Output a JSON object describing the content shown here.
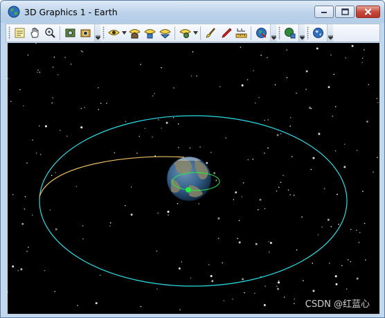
{
  "window": {
    "title": "3D Graphics 1 - Earth",
    "title_icon": "globe-icon",
    "buttons": [
      "minimize-icon",
      "maximize-icon",
      "close-icon"
    ]
  },
  "toolbar": {
    "groups": [
      [
        "properties-icon",
        "pan-hand-icon",
        "zoom-icon",
        "map-snapshot-icon",
        "camera-icon"
      ],
      [
        "view-from-icon",
        "home-view-icon",
        "view-object-icon",
        "orbit-view-icon"
      ],
      [
        "view-settings-icon",
        "brush-icon",
        "pen-icon",
        "measure-icon",
        "globe-select-icon"
      ],
      [
        "globe-manager-icon"
      ],
      [
        "earth-view-icon"
      ]
    ]
  },
  "scene": {
    "background_color": "#000000",
    "orbit_color": "#27e0e6",
    "trajectory_color": "#e8c060",
    "satellite_color": "#22ee44",
    "earth_ocean_color": "#33608a",
    "earth_land_color": "#8a8668"
  },
  "watermark": "CSDN @红蓝心"
}
